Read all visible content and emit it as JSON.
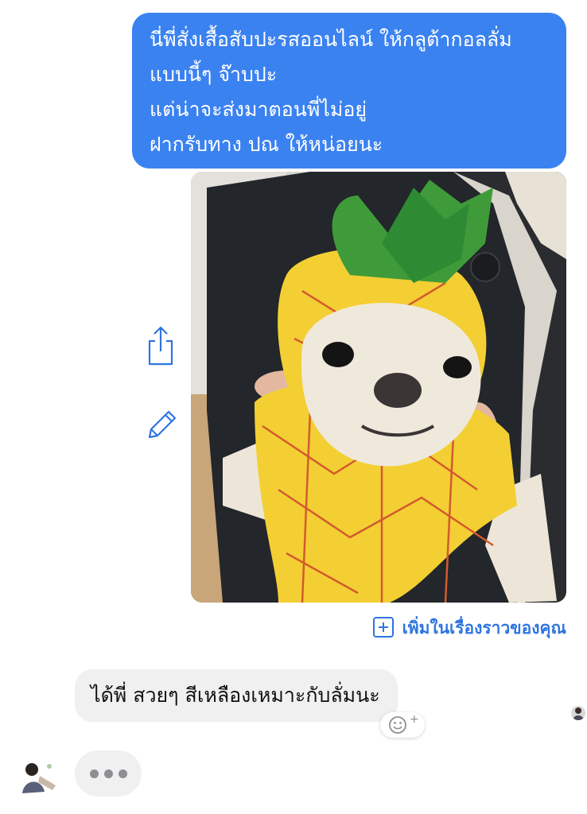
{
  "conversation": {
    "outgoing_message": {
      "lines": [
        "นี่พี่สั่งเสื้อสับปะรสออนไลน์ ให้กลูต้ากอลลั่ม",
        "แบบนี้ๆ จ๊าบปะ",
        "แต่น่าจะส่งมาตอนพี่ไม่อยู่",
        "ฝากรับทาง ปณ ให้หน่อยนะ"
      ],
      "bubble_color": "#3b82f1"
    },
    "photo": {
      "subject": "french-bulldog-in-pineapple-costume"
    },
    "message_actions": {
      "share_icon": "share-icon",
      "edit_icon": "pencil-icon"
    },
    "add_to_story": {
      "icon": "plus-square-icon",
      "label": "เพิ่มในเรื่องราวของคุณ",
      "color": "#2f75df"
    },
    "incoming_message": {
      "text": "ได้พี่ สวยๆ สีเหลืองเหมาะกับลั่มนะ",
      "bubble_color": "#f0f0f0"
    },
    "reaction_button": {
      "icon": "add-reaction-icon",
      "plus": "+"
    },
    "typing_indicator": {
      "icon": "typing-dots"
    }
  }
}
